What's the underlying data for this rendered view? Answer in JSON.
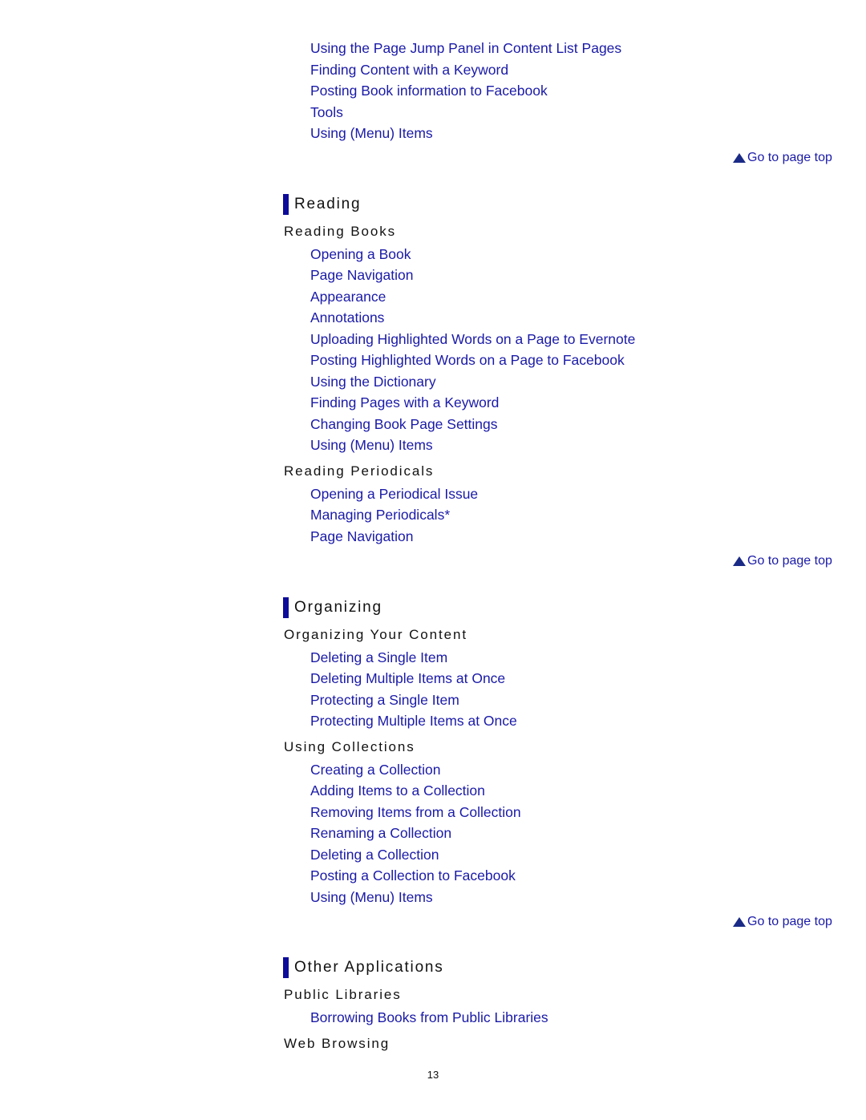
{
  "colors": {
    "link": "#1a1aa8",
    "section_bar": "#0c0c98",
    "text": "#111111"
  },
  "top_links": [
    "Using the Page Jump Panel in Content List Pages",
    "Finding Content with a Keyword",
    "Posting Book information to Facebook",
    "Tools",
    "Using (Menu) Items"
  ],
  "go_to_top_label": "Go to page top",
  "go_to_top_icon": "up-triangle-icon",
  "sections": {
    "reading": {
      "title": "Reading",
      "reading_books": {
        "title": "Reading Books",
        "links": [
          "Opening a Book",
          "Page Navigation",
          "Appearance",
          "Annotations",
          "Uploading Highlighted Words on a Page to Evernote",
          "Posting Highlighted Words on a Page to Facebook",
          "Using the Dictionary",
          "Finding Pages with a Keyword",
          "Changing Book Page Settings",
          "Using (Menu) Items"
        ]
      },
      "reading_periodicals": {
        "title": "Reading Periodicals",
        "links": [
          "Opening a Periodical Issue",
          "Managing Periodicals*",
          "Page Navigation"
        ]
      }
    },
    "organizing": {
      "title": "Organizing",
      "organizing_content": {
        "title": "Organizing Your Content",
        "links": [
          "Deleting a Single Item",
          "Deleting Multiple Items at Once",
          "Protecting a Single Item",
          "Protecting Multiple Items at Once"
        ]
      },
      "using_collections": {
        "title": "Using Collections",
        "links": [
          "Creating a Collection",
          "Adding Items to a Collection",
          "Removing Items from a Collection",
          "Renaming a Collection",
          "Deleting a Collection",
          "Posting a Collection to Facebook",
          "Using (Menu) Items"
        ]
      }
    },
    "other": {
      "title": "Other Applications",
      "public_libraries": {
        "title": "Public Libraries",
        "links": [
          "Borrowing Books from Public Libraries"
        ]
      },
      "web_browsing": {
        "title": "Web Browsing"
      }
    }
  },
  "page_number": "13"
}
